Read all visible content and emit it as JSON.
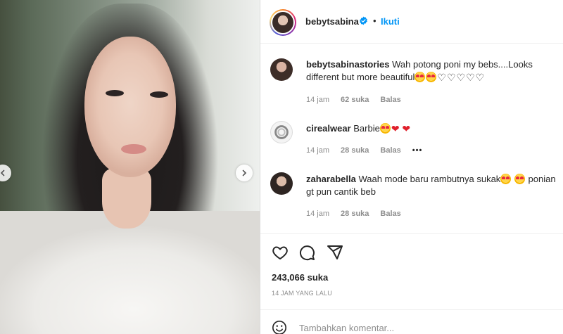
{
  "post": {
    "author": "bebytsabina",
    "follow_label": "Ikuti",
    "dot": "•",
    "likes": "243,066 suka",
    "time_ago": "14 JAM YANG LALU",
    "comment_placeholder": "Tambahkan komentar..."
  },
  "comments": [
    {
      "user": "bebytsabinastories",
      "text_before": "Wah potong poni my bebs....Looks different but more beautiful",
      "outline_hearts": "♡♡♡♡♡",
      "time": "14 jam",
      "likes": "62 suka",
      "reply": "Balas"
    },
    {
      "user": "cirealwear",
      "text_before": "Barbie",
      "red_hearts": "❤ ❤",
      "time": "14 jam",
      "likes": "28 suka",
      "reply": "Balas",
      "more": "•••"
    },
    {
      "user": "zaharabella",
      "text_before": "Waah mode baru rambutnya sukak",
      "text_after": "gt pun cantik beb",
      "text_mid": " ponian",
      "time": "14 jam",
      "likes": "28 suka",
      "reply": "Balas"
    }
  ],
  "icons": {
    "verified": "verified-badge-icon",
    "like": "heart-outline-icon",
    "comment": "comment-icon",
    "share": "share-icon",
    "emoji": "emoji-icon"
  },
  "colors": {
    "accent": "#0095f6",
    "text": "#262626",
    "muted": "#8e8e8e"
  }
}
